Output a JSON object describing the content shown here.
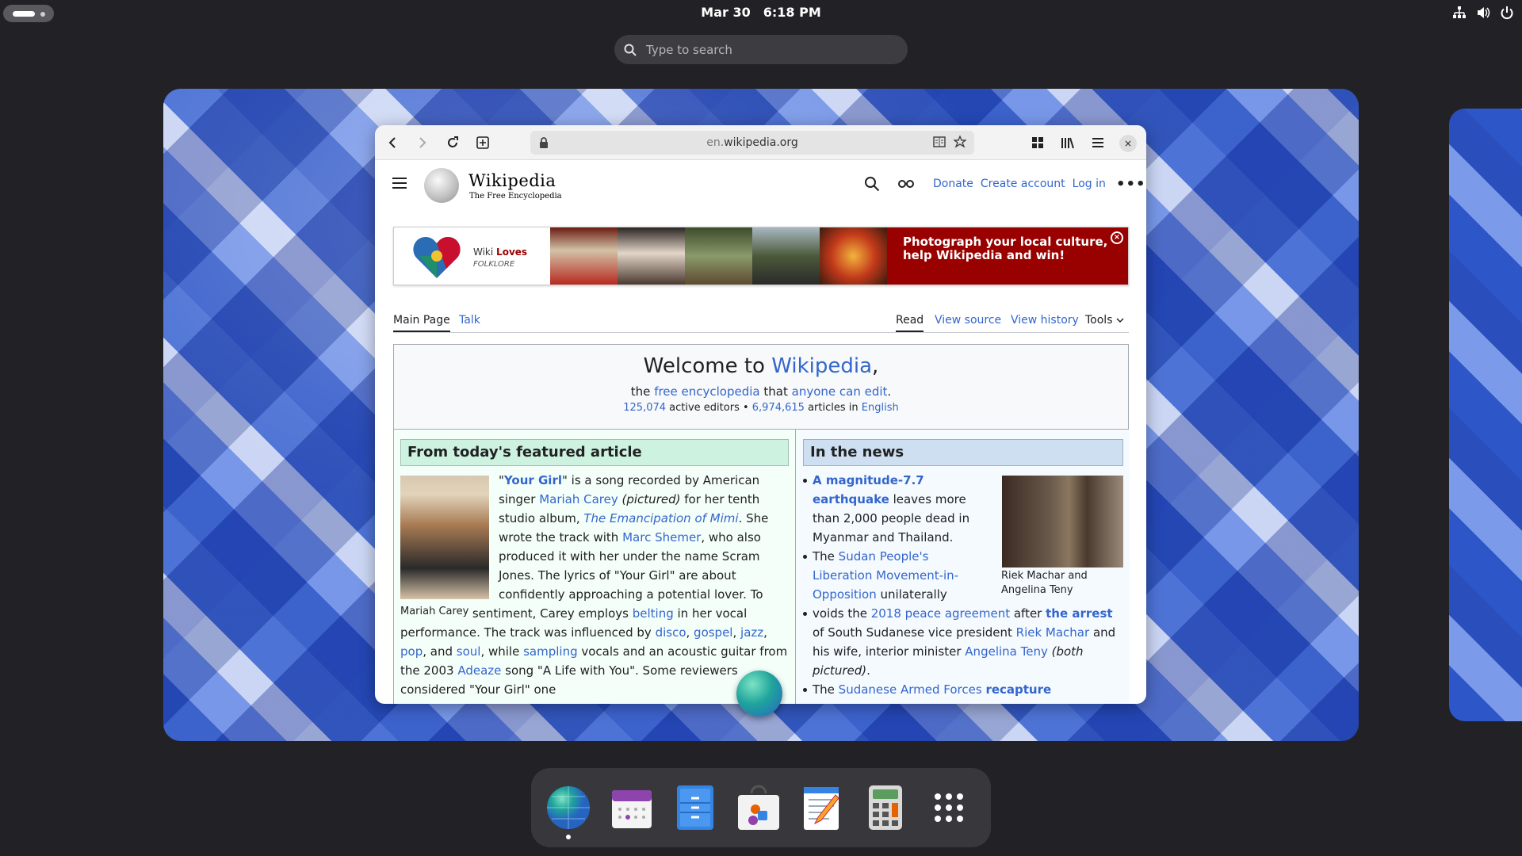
{
  "topbar": {
    "date": "Mar 30",
    "time": "6:18 PM"
  },
  "search": {
    "placeholder": "Type to search"
  },
  "browser": {
    "url_domain": "en.",
    "url_rest": "wikipedia.org",
    "close": "×"
  },
  "wiki": {
    "wordmark": "Wikipedia",
    "tagline": "The Free Encyclopedia",
    "header_links": [
      "Donate",
      "Create account",
      "Log in"
    ],
    "more": "•••",
    "banner": {
      "brand_wiki": "Wiki",
      "brand_loves": "Loves",
      "brand_folklore": "FOLKLORE",
      "cta": "Photograph your local culture, help Wikipedia and win!",
      "close": "×"
    },
    "tabs_left": [
      "Main Page",
      "Talk"
    ],
    "tabs_right": [
      "Read",
      "View source",
      "View history",
      "Tools"
    ],
    "welcome": {
      "prefix": "Welcome to ",
      "link": "Wikipedia",
      "suffix": ",",
      "line2_a": "the ",
      "line2_link1": "free encyclopedia",
      "line2_b": " that ",
      "line2_link2": "anyone can edit",
      "line2_c": ".",
      "editors": "125,074",
      "editors_label": " active editors • ",
      "articles": "6,974,615",
      "articles_label": " articles in ",
      "language": "English"
    },
    "featured": {
      "heading": "From today's featured article",
      "caption": "Mariah Carey"
    },
    "news": {
      "heading": "In the news",
      "caption": "Riek Machar and Angelina Teny"
    }
  },
  "colors": {
    "link": "#3366cc",
    "banner_red": "#990000",
    "featured_bg": "#cef2e0",
    "news_bg": "#cedff2"
  },
  "dock": {
    "apps": [
      "web-browser",
      "calendar",
      "files",
      "software",
      "text-editor",
      "calculator",
      "app-grid"
    ]
  }
}
